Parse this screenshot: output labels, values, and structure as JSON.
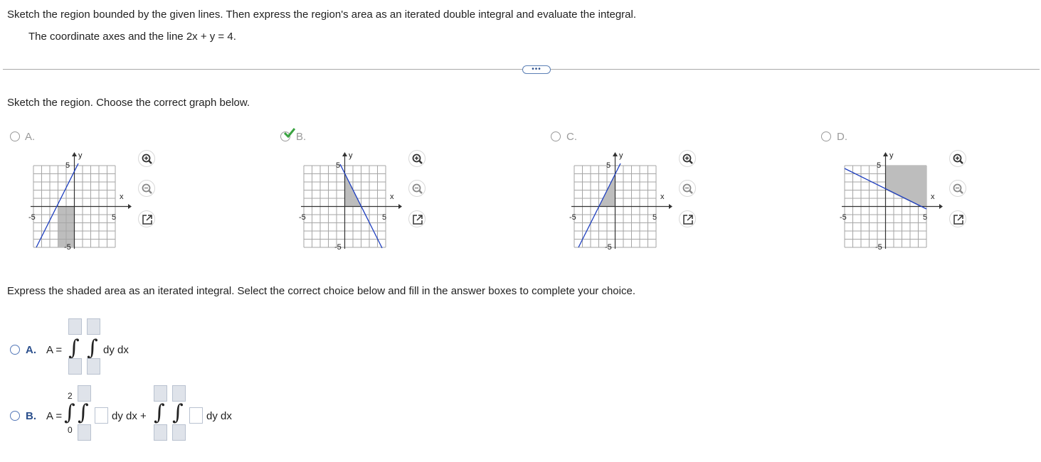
{
  "question": {
    "instruction": "Sketch the region bounded by the given lines. Then express the region's area as an iterated double integral and evaluate the integral.",
    "given": "The coordinate axes and the line 2x + y = 4."
  },
  "more_button": "•••",
  "part1": {
    "prompt": "Sketch the region. Choose the correct graph below.",
    "options": [
      {
        "label": "A.",
        "selected": false
      },
      {
        "label": "B.",
        "selected": true
      },
      {
        "label": "C.",
        "selected": false
      },
      {
        "label": "D.",
        "selected": false
      }
    ],
    "graph_labels": {
      "y": "y",
      "x": "x",
      "five": "5",
      "neg_five": "-5"
    }
  },
  "part2": {
    "prompt": "Express the shaded area as an iterated integral. Select the correct choice below and fill in the answer boxes to complete your choice.",
    "choice_a": {
      "label": "A.",
      "lhs": "A =",
      "differential": "dy dx"
    },
    "choice_b": {
      "label": "B.",
      "lhs": "A =",
      "upper": "2",
      "lower": "0",
      "differential1": "dy dx +",
      "differential2": "dy dx"
    }
  },
  "colors": {
    "accent": "#2b4f8c",
    "check": "#3aa341",
    "line": "#1f3fbf",
    "shade": "#bdbdbd"
  },
  "icons": [
    "zoom-in-icon",
    "zoom-out-icon",
    "popout-icon",
    "checkmark-icon"
  ]
}
